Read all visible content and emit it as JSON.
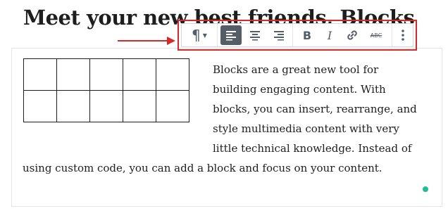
{
  "heading": {
    "text": "Meet your new best friends, Blocks"
  },
  "paragraph": {
    "text": "Blocks are a great new tool for building engaging content. With blocks, you can insert, rearrange, and style multimedia content with very little technical knowledge. Instead of using custom code, you can add a block and focus on your content."
  },
  "table": {
    "rows": 2,
    "cols": 5
  },
  "toolbar": {
    "items": [
      {
        "name": "paragraph-block-type",
        "icon": "pilcrow-icon"
      },
      {
        "name": "align-left",
        "icon": "align-left-icon",
        "active": true
      },
      {
        "name": "align-center",
        "icon": "align-center-icon"
      },
      {
        "name": "align-right",
        "icon": "align-right-icon"
      },
      {
        "name": "bold",
        "icon": "bold-icon",
        "label": "B"
      },
      {
        "name": "italic",
        "icon": "italic-icon",
        "label": "I"
      },
      {
        "name": "link",
        "icon": "link-icon"
      },
      {
        "name": "strikethrough",
        "icon": "strikethrough-icon",
        "label": "ABC"
      },
      {
        "name": "more-options",
        "icon": "vertical-ellipsis-icon"
      }
    ],
    "pilcrow": "¶",
    "bold_label": "B",
    "italic_label": "I",
    "strike_label": "ABC",
    "ellipsis": "⋮"
  },
  "colors": {
    "annotation": "#d42a2a",
    "active_button": "#555d66",
    "status_dot": "#1fbf8f"
  }
}
